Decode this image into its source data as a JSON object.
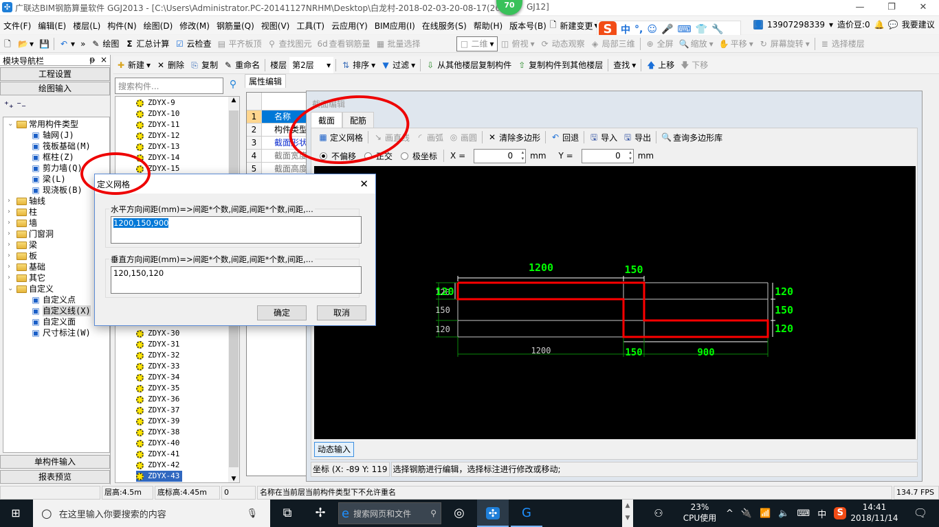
{
  "window": {
    "title": "广联达BIM钢筋算量软件 GGJ2013 - [C:\\Users\\Administrator.PC-20141127NRHM\\Desktop\\白龙村-2018-02-03-20-08-17(26",
    "title_tail": "GJ12]",
    "badge": "70",
    "min": "—",
    "max": "❐",
    "close": "✕"
  },
  "menu": [
    "文件(F)",
    "编辑(E)",
    "楼层(L)",
    "构件(N)",
    "绘图(D)",
    "修改(M)",
    "钢筋量(Q)",
    "视图(V)",
    "工具(T)",
    "云应用(Y)",
    "BIM应用(I)",
    "在线服务(S)",
    "帮助(H)",
    "版本号(B)",
    "新建变更"
  ],
  "ime": {
    "mode": "中",
    "punct": "°,"
  },
  "account": {
    "phone": "13907298339",
    "beans": "造价豆:0",
    "suggest": "我要建议"
  },
  "toolbar1": {
    "draw": "绘图",
    "sum": "汇总计算",
    "cloud_check": "云检查",
    "align": "平齐板顶",
    "find": "查找图元",
    "view_rebar": "查看钢筋量",
    "batch": "批量选择",
    "view_mode": "二维",
    "top_view": "俯视",
    "orbit": "动态观察",
    "local3d": "局部三维",
    "fullscreen": "全屏",
    "zoom": "缩放",
    "pan": "平移",
    "rotate": "屏幕旋转",
    "select_floor": "选择楼层"
  },
  "toolbar2": {
    "new": "新建",
    "delete": "删除",
    "copy": "复制",
    "rename": "重命名",
    "floor_label": "楼层",
    "floor_value": "第2层",
    "sort": "排序",
    "filter": "过滤",
    "copy_from": "从其他楼层复制构件",
    "copy_to": "复制构件到其他楼层",
    "find": "查找",
    "up": "上移",
    "down": "下移"
  },
  "nav": {
    "title": "模块导航栏",
    "pin": "ᵽ",
    "close": "×",
    "project_settings": "工程设置",
    "drawing_input": "绘图输入",
    "single_input": "单构件输入",
    "report": "报表预览",
    "tree": [
      {
        "label": "常用构件类型",
        "level": 0,
        "open": true
      },
      {
        "label": "轴网(J)",
        "level": 1
      },
      {
        "label": "筏板基础(M)",
        "level": 1
      },
      {
        "label": "框柱(Z)",
        "level": 1
      },
      {
        "label": "剪力墙(Q)",
        "level": 1
      },
      {
        "label": "梁(L)",
        "level": 1
      },
      {
        "label": "现浇板(B)",
        "level": 1
      },
      {
        "label": "轴线",
        "level": 0
      },
      {
        "label": "柱",
        "level": 0
      },
      {
        "label": "墙",
        "level": 0
      },
      {
        "label": "门窗洞",
        "level": 0
      },
      {
        "label": "梁",
        "level": 0
      },
      {
        "label": "板",
        "level": 0
      },
      {
        "label": "基础",
        "level": 0
      },
      {
        "label": "其它",
        "level": 0
      },
      {
        "label": "自定义",
        "level": 0,
        "open": true
      },
      {
        "label": "自定义点",
        "level": 1
      },
      {
        "label": "自定义线(X)",
        "level": 1,
        "selected": true
      },
      {
        "label": "自定义面",
        "level": 1
      },
      {
        "label": "尺寸标注(W)",
        "level": 1
      }
    ]
  },
  "components": {
    "search_placeholder": "搜索构件...",
    "top": [
      "ZDYX-9",
      "ZDYX-10",
      "ZDYX-11",
      "ZDYX-12",
      "ZDYX-13",
      "ZDYX-14",
      "ZDYX-15"
    ],
    "bottom": [
      "ZDYX-30",
      "ZDYX-31",
      "ZDYX-32",
      "ZDYX-33",
      "ZDYX-34",
      "ZDYX-35",
      "ZDYX-36",
      "ZDYX-37",
      "ZDYX-39",
      "ZDYX-38",
      "ZDYX-40",
      "ZDYX-41",
      "ZDYX-42",
      "ZDYX-43"
    ],
    "selected": "ZDYX-43"
  },
  "props": {
    "tab": "属性编辑",
    "rows": [
      {
        "n": "1",
        "v": "名称"
      },
      {
        "n": "2",
        "v": "构件类型"
      },
      {
        "n": "3",
        "v": "截面形状"
      },
      {
        "n": "4",
        "v": "截面宽度"
      },
      {
        "n": "5",
        "v": "截面高度"
      }
    ]
  },
  "section": {
    "title": "截面编辑",
    "tabs": [
      "截面",
      "配筋"
    ],
    "tools": {
      "grid": "定义网格",
      "line": "画直线",
      "arc": "画弧",
      "circle": "画圆",
      "clear": "清除多边形",
      "undo": "回退",
      "import": "导入",
      "export": "导出",
      "query": "查询多边形库"
    },
    "modes": [
      "不偏移",
      "正交",
      "极坐标"
    ],
    "x_label": "X =",
    "x_value": "0",
    "y_label": "Y =",
    "y_value": "0",
    "unit": "mm",
    "dynamic": "动态输入",
    "coord": "坐标 (X: -89 Y: 119",
    "hint": "选择钢筋进行编辑，选择标注进行修改或移动;",
    "dims": {
      "top": [
        "1200",
        "150"
      ],
      "left": [
        "120",
        "150",
        "120"
      ],
      "right": [
        "120",
        "150",
        "120"
      ],
      "bottom_white": "1200",
      "bottom_green": [
        "150",
        "900"
      ],
      "left_overlay": "120"
    }
  },
  "dialog": {
    "title": "定义网格",
    "h_label": "水平方向间距(mm)=>间距*个数,间距,间距*个数,间距,...",
    "h_value": "1200,150,900",
    "v_label": "垂直方向间距(mm)=>间距*个数,间距,间距*个数,间距,...",
    "v_value": "120,150,120",
    "ok": "确定",
    "cancel": "取消"
  },
  "status": {
    "floor_height": "层高:4.5m",
    "base_elev": "底标高:4.45m",
    "zero": "0",
    "message": "名称在当前层当前构件类型下不允许重名",
    "fps": "134.7 FPS"
  },
  "taskbar": {
    "search": "在这里输入你要搜索的内容",
    "browser_search": "搜索网页和文件",
    "cpu_pct": "23%",
    "cpu_label": "CPU使用",
    "lang": "中",
    "time": "14:41",
    "date": "2018/11/14"
  },
  "colors": {
    "accent": "#0078d7",
    "canvas": "#000000",
    "dim_green": "#00ff00",
    "polygon": "#ff0000",
    "annotation": "#e00000"
  }
}
